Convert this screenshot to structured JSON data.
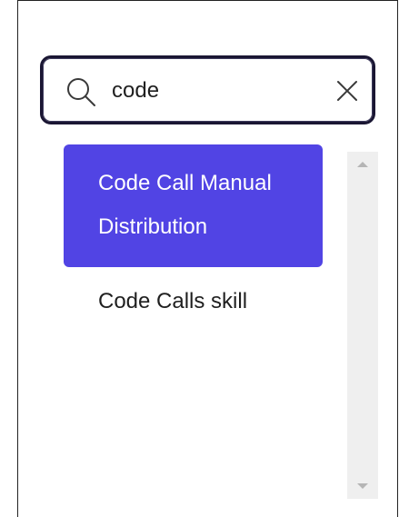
{
  "search": {
    "value": "code",
    "icon": "search-icon",
    "clear_icon": "close-icon"
  },
  "results": [
    {
      "label": "Code Call Manual Distribution",
      "selected": true
    },
    {
      "label": "Code Calls skill",
      "selected": false
    }
  ],
  "scrollbar": {
    "up_icon": "chevron-up-icon",
    "down_icon": "chevron-down-icon"
  },
  "colors": {
    "accent": "#5144e4",
    "search_border": "#1a1633",
    "scrollbar_track": "#efefef"
  }
}
